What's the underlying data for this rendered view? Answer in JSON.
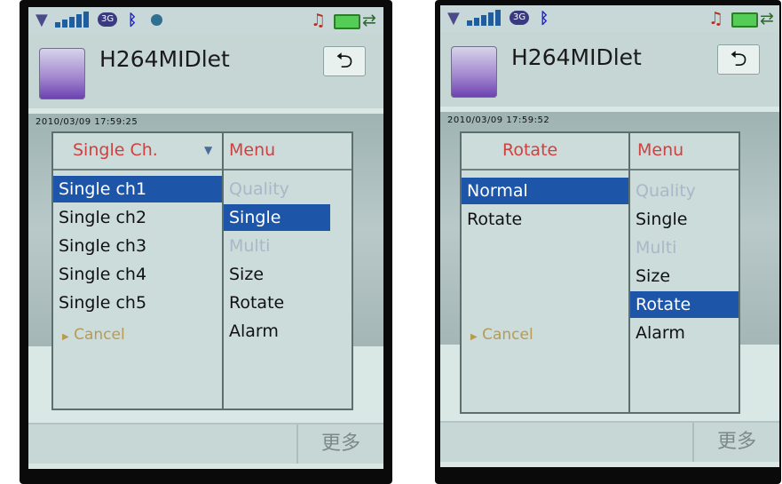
{
  "left": {
    "status": {
      "network": "3G"
    },
    "app_title": "H264MIDlet",
    "back_icon": "⮌",
    "timestamp": "2010/03/09 17:59:25",
    "submenu": {
      "title": "Single Ch.",
      "items": [
        "Single ch1",
        "Single ch2",
        "Single ch3",
        "Single ch4",
        "Single ch5"
      ],
      "selected": 0,
      "cancel": "Cancel"
    },
    "menu": {
      "title": "Menu",
      "items": [
        "Quality",
        "Single",
        "Multi",
        "Size",
        "Rotate",
        "Alarm"
      ],
      "selected": 1,
      "disabled": [
        0,
        2
      ]
    },
    "softkey_more": "更多"
  },
  "right": {
    "status": {
      "network": "3G"
    },
    "app_title": "H264MIDlet",
    "back_icon": "⮌",
    "timestamp": "2010/03/09 17:59:52",
    "submenu": {
      "title": "Rotate",
      "items": [
        "Normal",
        "Rotate"
      ],
      "selected": 0,
      "cancel": "Cancel"
    },
    "menu": {
      "title": "Menu",
      "items": [
        "Quality",
        "Single",
        "Multi",
        "Size",
        "Rotate",
        "Alarm"
      ],
      "selected": 4,
      "disabled": [
        0,
        2
      ]
    },
    "softkey_more": "更多"
  }
}
